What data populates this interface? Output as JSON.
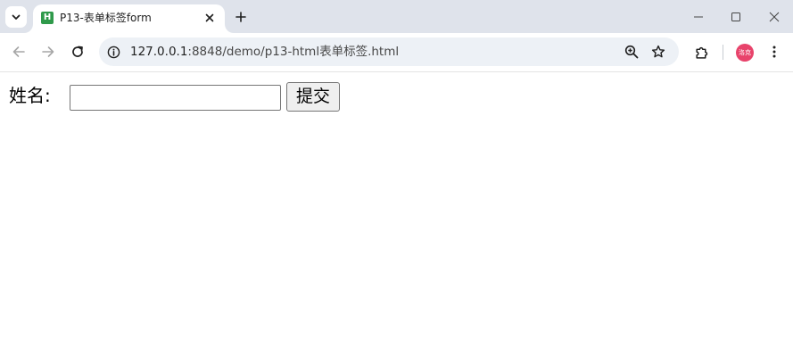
{
  "browser": {
    "tab": {
      "favicon_letter": "H",
      "title": "P13-表单标签form"
    },
    "address_bar": {
      "host": "127.0.0.1",
      "path": ":8848/demo/p13-html表单标签.html"
    },
    "profile": {
      "initials": "洛克",
      "color": "#e8436b"
    }
  },
  "page": {
    "form": {
      "name_label": "姓名:",
      "name_value": "",
      "submit_label": "提交"
    }
  }
}
